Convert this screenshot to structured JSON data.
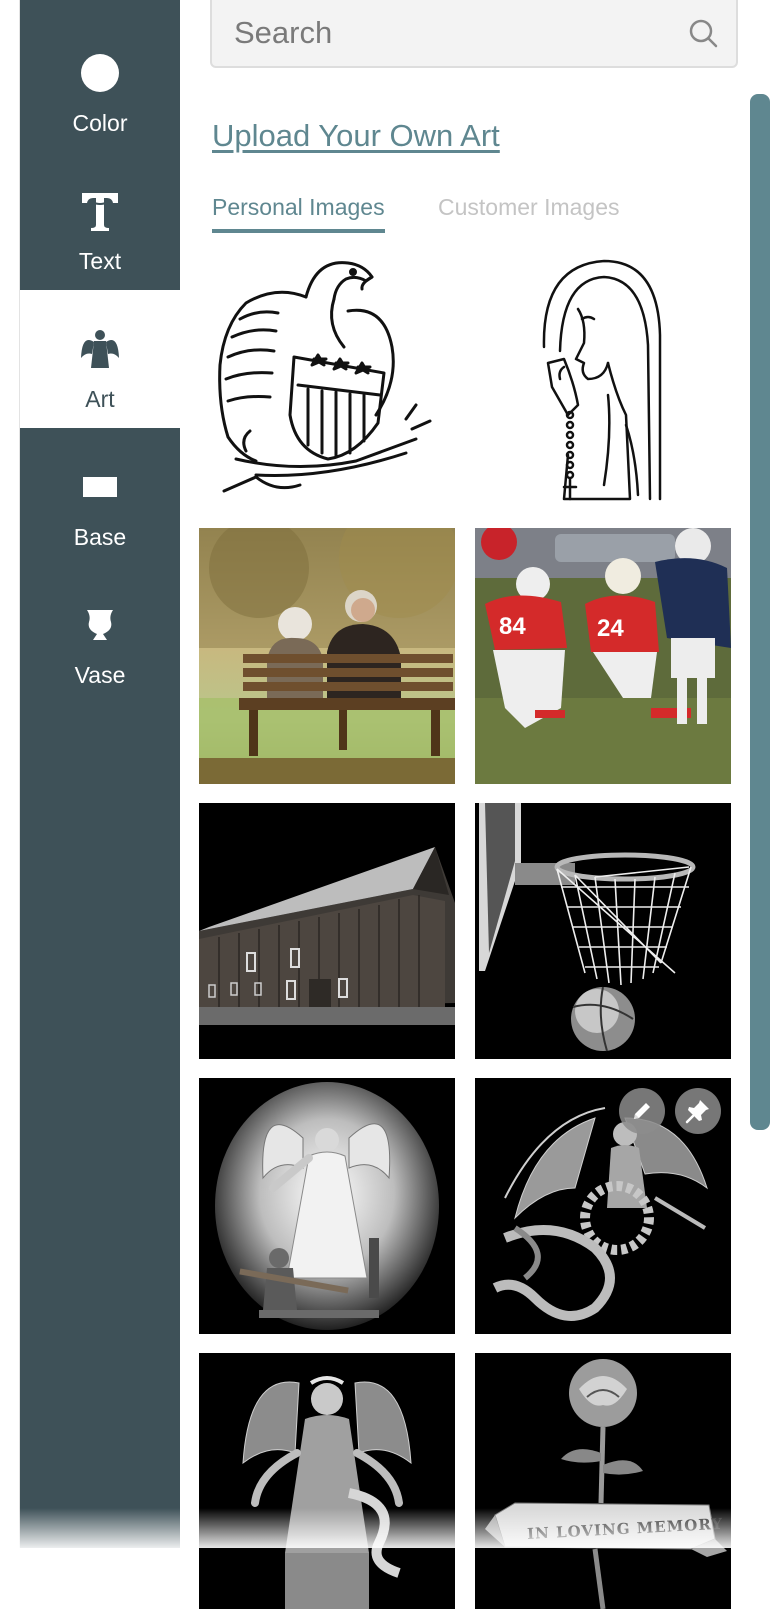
{
  "sidebar": {
    "items": [
      {
        "label": "Color",
        "icon": "circle-icon"
      },
      {
        "label": "Text",
        "icon": "text-t-icon"
      },
      {
        "label": "Art",
        "icon": "angel-icon"
      },
      {
        "label": "Base",
        "icon": "base-rectangle-icon"
      },
      {
        "label": "Vase",
        "icon": "vase-icon"
      }
    ],
    "active": "Art"
  },
  "search": {
    "placeholder": "Search",
    "value": ""
  },
  "upload_link": "Upload Your Own Art",
  "tabs": [
    {
      "label": "Personal Images",
      "active": true
    },
    {
      "label": "Customer Images",
      "active": false
    }
  ],
  "tiles": [
    {
      "name": "eagle-shield-art"
    },
    {
      "name": "praying-virgin-mary-art"
    },
    {
      "name": "couple-on-bench-photo"
    },
    {
      "name": "football-players-photo"
    },
    {
      "name": "barn-photo"
    },
    {
      "name": "basketball-hoop-photo"
    },
    {
      "name": "guardian-angel-photo"
    },
    {
      "name": "angel-wreath-art"
    },
    {
      "name": "angel-woman-art"
    },
    {
      "name": "rose-memory-art",
      "banner_text": "IN LOVING MEMORY"
    }
  ],
  "tile_actions": {
    "edit_icon": "pencil-icon",
    "pin_icon": "pin-icon"
  },
  "colors": {
    "sidebar": "#3e5158",
    "accent": "#5f8790",
    "inactive_tab": "#c4c4c4"
  }
}
